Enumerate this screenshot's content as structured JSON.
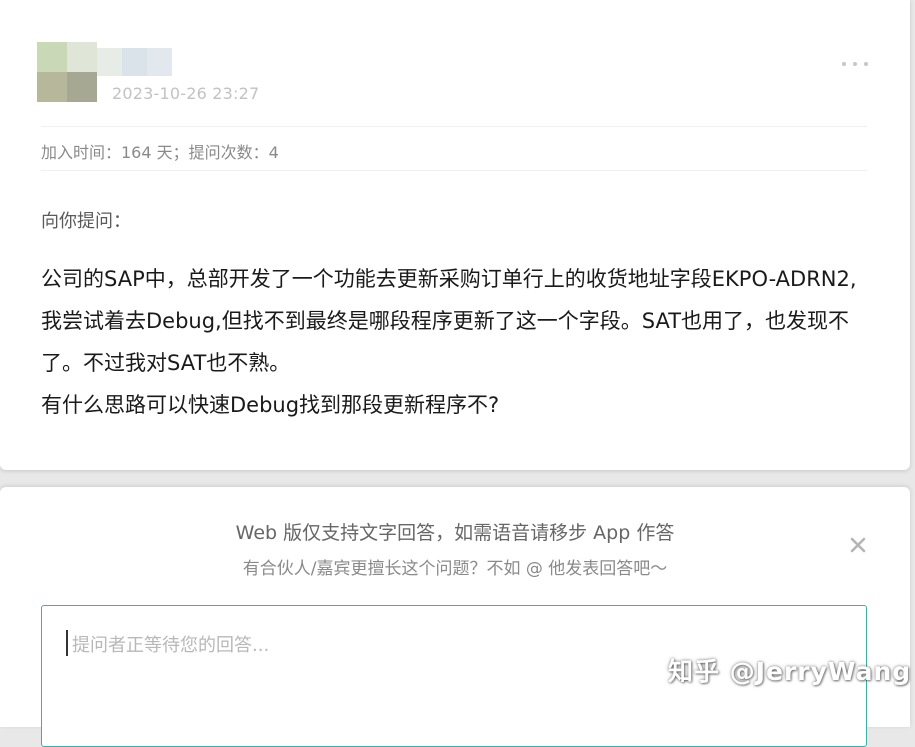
{
  "question_card": {
    "timestamp": "2023-10-26 23:27",
    "join_info": "加入时间：164 天；提问次数：4",
    "ask_label": "向你提问：",
    "body_lines": [
      "公司的SAP中，总部开发了一个功能去更新采购订单行上的收货地址字段EKPO-ADRN2,我尝试着去Debug,但找不到最终是哪段程序更新了这一个字段。SAT也用了，也发现不了。不过我对SAT也不熟。",
      "有什么思路可以快速Debug找到那段更新程序不?"
    ],
    "more_icon": "more-dots-icon"
  },
  "answer_card": {
    "notice": "Web 版仅支持文字回答，如需语音请移步 App 作答",
    "invite_hint": "有合伙人/嘉宾更擅长这个问题？不如 @ 他发表回答吧～",
    "close_icon": "close-icon",
    "answer_placeholder": "提问者正等待您的回答..."
  },
  "watermark": "知乎 @JerryWang",
  "colors": {
    "accent_border": "#39b1a8",
    "muted_text": "#8a8a8a",
    "body_text": "#1a1a1a"
  }
}
